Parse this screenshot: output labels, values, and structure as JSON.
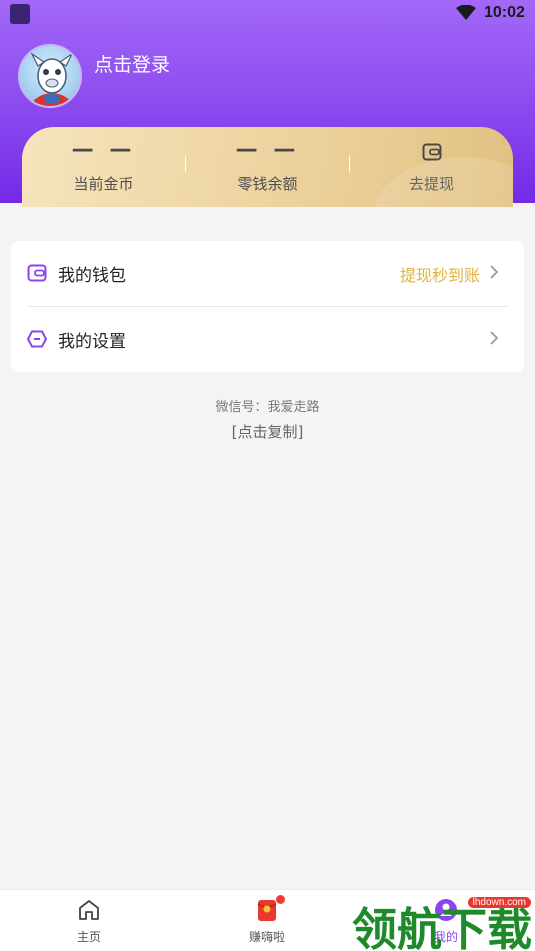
{
  "status_bar": {
    "time": "10:02"
  },
  "header": {
    "login_text": "点击登录",
    "stats": [
      {
        "value": "— —",
        "label": "当前金币"
      },
      {
        "value": "— —",
        "label": "零钱余额"
      },
      {
        "value": "",
        "label": "去提现",
        "icon": "wallet-icon"
      }
    ]
  },
  "menu": [
    {
      "label": "我的钱包",
      "hint": "提现秒到账",
      "icon": "wallet-icon"
    },
    {
      "label": "我的设置",
      "hint": "",
      "icon": "hexagon-settings-icon"
    }
  ],
  "footer_info": {
    "wechat": "微信号：我爱走路",
    "copy": "[点击复制]"
  },
  "tabs": [
    {
      "label": "主页",
      "icon": "home-icon"
    },
    {
      "label": "赚嗨啦",
      "icon": "red-packet-icon"
    },
    {
      "label": "我的",
      "icon": "profile-icon",
      "active": true
    }
  ],
  "watermark": {
    "text": "领航下载",
    "url": "lhdown.com"
  },
  "colors": {
    "accent": "#8b45f0",
    "gold": "#e2b43a",
    "badge": "#f23a3a"
  }
}
